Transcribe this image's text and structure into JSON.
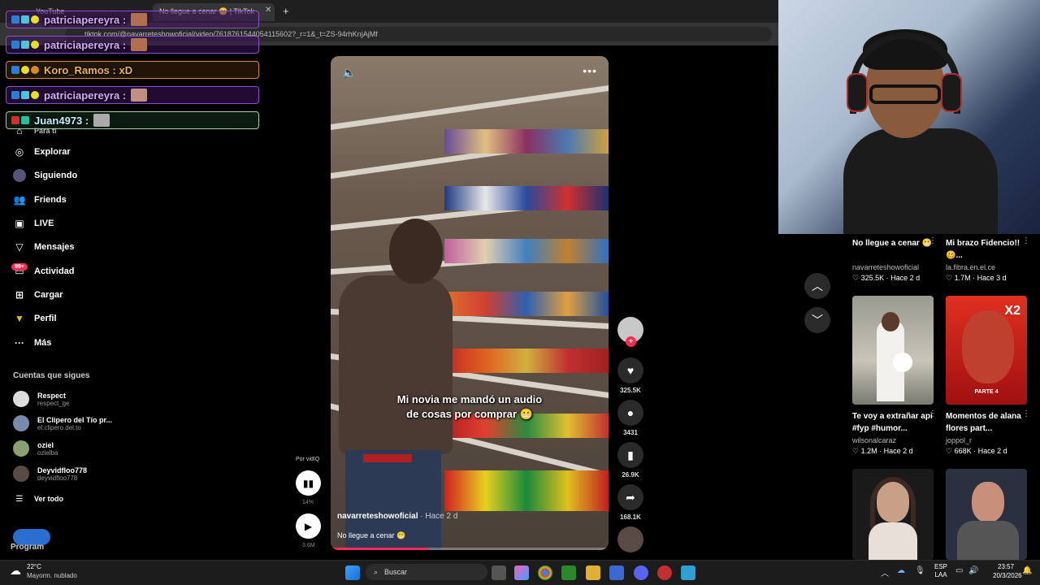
{
  "browser": {
    "tabs": [
      {
        "label": "YouTube"
      },
      {
        "label": "No llegue a cenar 😬 | TikTok"
      }
    ],
    "url": "tiktok.com/@navarreteshowoficial/video/7618761544054115602?_r=1&_t=ZS-94rhKnjAjMf"
  },
  "chat": [
    {
      "user": "patriciapereyra :",
      "msg": ""
    },
    {
      "user": "patriciapereyra :",
      "msg": ""
    },
    {
      "user": "Koro_Ramos :",
      "msg": "xD"
    },
    {
      "user": "patriciapereyra :",
      "msg": ""
    },
    {
      "user": "Juan4973 :",
      "msg": ""
    }
  ],
  "sidebar": {
    "items": [
      {
        "label": "Para ti",
        "icon": "home-icon"
      },
      {
        "label": "Explorar",
        "icon": "compass-icon"
      },
      {
        "label": "Siguiendo",
        "icon": "following-icon"
      },
      {
        "label": "Friends",
        "icon": "friends-icon"
      },
      {
        "label": "LIVE",
        "icon": "live-icon"
      },
      {
        "label": "Mensajes",
        "icon": "messages-icon"
      },
      {
        "label": "Actividad",
        "icon": "activity-icon"
      },
      {
        "label": "Cargar",
        "icon": "upload-icon"
      },
      {
        "label": "Perfil",
        "icon": "profile-icon"
      },
      {
        "label": "Más",
        "icon": "more-icon"
      }
    ],
    "activity_badge": "99+",
    "following_title": "Cuentas que sigues",
    "following": [
      {
        "name": "Respect",
        "handle": "respect_ge"
      },
      {
        "name": "El Clipero del Tío pr...",
        "handle": "el.clipero.del.to"
      },
      {
        "name": "oziel",
        "handle": "ozielba"
      },
      {
        "name": "Deyvidfloo778",
        "handle": "deyvidfloo778"
      }
    ],
    "see_all": "Ver todo",
    "footer_program": "Program"
  },
  "video": {
    "caption_line1": "Mi novia me mandó un audio",
    "caption_line2": "de cosas por comprar 😬",
    "author": "navarreteshowoficial",
    "ago": " · Hace 2 d",
    "description": "No llegue a cenar 😬",
    "progress_fraction": 0.35
  },
  "actions": {
    "likes": "325.5K",
    "comments": "3431",
    "saves": "26.9K",
    "shares": "168.1K"
  },
  "vidiq": {
    "label": "Por vidIQ",
    "percent": "14%",
    "views": "3.6M"
  },
  "grid": [
    {
      "title": "No llegue a cenar 😬",
      "user": "navarreteshowoficial",
      "stats": "♡ 325.5K · Hace 2 d"
    },
    {
      "title": "Mi brazo Fidencio!! 🥴...",
      "user": "la.fibra.en.el.ce",
      "stats": "♡ 1.7M · Hace 3 d"
    },
    {
      "title": "Te voy a extrañar api #fyp #humor...",
      "user": "wilsonalcaraz",
      "stats": "♡ 1.2M · Hace 2 d"
    },
    {
      "title": "Momentos de alana flores part...",
      "user": "joppol_r",
      "stats": "♡ 668K · Hace 2 d"
    }
  ],
  "thumb_texts": {
    "parte": "PARTE 4",
    "x2": "X2"
  },
  "taskbar": {
    "temp": "22°C",
    "weather": "Mayorm. nublado",
    "search": "Buscar",
    "lang1": "ESP",
    "lang2": "LAA",
    "time": "23:57",
    "date": "20/3/2026"
  },
  "colors": {
    "accent": "#fe2c55",
    "purple_border": "#8a4fd0"
  }
}
